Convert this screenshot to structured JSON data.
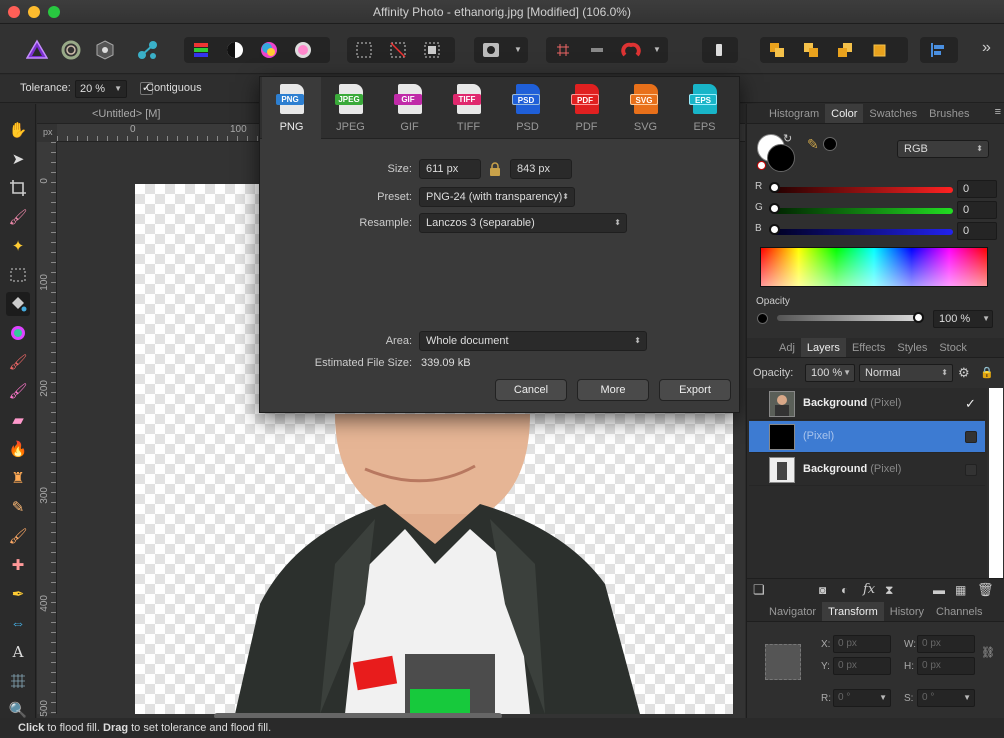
{
  "window": {
    "title": "Affinity Photo - ethanorig.jpg [Modified] (106.0%)",
    "traffic_colors": [
      "#ff5f57",
      "#febc2e",
      "#28c840"
    ]
  },
  "context_toolbar": {
    "tolerance_label": "Tolerance:",
    "tolerance_value": "20 %",
    "contiguous_label": "Contiguous",
    "contiguous_checked": true
  },
  "document": {
    "untitled_tab": "<Untitled> [M]"
  },
  "rulers": {
    "unit": "px",
    "h_ticks": [
      "0",
      "100"
    ],
    "v_ticks": [
      "0",
      "100",
      "200",
      "300",
      "400",
      "500"
    ]
  },
  "export_dialog": {
    "formats": [
      {
        "tag": "PNG",
        "label": "PNG",
        "color": "#2d7fd1",
        "selected": true
      },
      {
        "tag": "JPEG",
        "label": "JPEG",
        "color": "#3aaa3a",
        "selected": false
      },
      {
        "tag": "GIF",
        "label": "GIF",
        "color": "#c02aa8",
        "selected": false
      },
      {
        "tag": "TIFF",
        "label": "TIFF",
        "color": "#e0286e",
        "selected": false
      },
      {
        "tag": "PSD",
        "label": "PSD",
        "color": "#1f5fd8",
        "selected": false
      },
      {
        "tag": "PDF",
        "label": "PDF",
        "color": "#e02020",
        "selected": false
      },
      {
        "tag": "SVG",
        "label": "SVG",
        "color": "#e8701a",
        "selected": false
      },
      {
        "tag": "EPS",
        "label": "EPS",
        "color": "#18b5c8",
        "selected": false
      }
    ],
    "size_label": "Size:",
    "width_value": "611 px",
    "height_value": "843 px",
    "preset_label": "Preset:",
    "preset_value": "PNG-24 (with transparency)",
    "resample_label": "Resample:",
    "resample_value": "Lanczos 3 (separable)",
    "area_label": "Area:",
    "area_value": "Whole document",
    "filesize_label": "Estimated File Size:",
    "filesize_value": "339.09 kB",
    "cancel_label": "Cancel",
    "more_label": "More",
    "export_label": "Export"
  },
  "color_panel": {
    "tabs": [
      "Histogram",
      "Color",
      "Swatches",
      "Brushes"
    ],
    "active_tab": "Color",
    "model": "RGB",
    "r_label": "R",
    "r_value": "0",
    "g_label": "G",
    "g_value": "0",
    "b_label": "B",
    "b_value": "0",
    "opacity_label": "Opacity",
    "opacity_value": "100 %",
    "opacity_level": 1.0
  },
  "layers_panel": {
    "tabs": [
      "Adj",
      "Layers",
      "Effects",
      "Styles",
      "Stock"
    ],
    "active_tab": "Layers",
    "opacity_label": "Opacity:",
    "opacity_value": "100 %",
    "blend_mode": "Normal",
    "layers": [
      {
        "name": "Background",
        "type": "(Pixel)",
        "selected": false,
        "visible": true
      },
      {
        "name": "",
        "type": "(Pixel)",
        "selected": true,
        "visible": true
      },
      {
        "name": "Background",
        "type": "(Pixel)",
        "selected": false,
        "visible": false
      }
    ],
    "fx_label": "fx"
  },
  "transform_panel": {
    "tabs": [
      "Navigator",
      "Transform",
      "History",
      "Channels"
    ],
    "active_tab": "Transform",
    "x_label": "X:",
    "x_value": "0 px",
    "y_label": "Y:",
    "y_value": "0 px",
    "w_label": "W:",
    "w_value": "0 px",
    "h_label": "H:",
    "h_value": "0 px",
    "r_label": "R:",
    "r_value": "0 °",
    "s_label": "S:",
    "s_value": "0 °"
  },
  "status": {
    "click": "Click",
    "text1": " to flood fill. ",
    "drag": "Drag",
    "text2": " to set tolerance and flood fill."
  }
}
